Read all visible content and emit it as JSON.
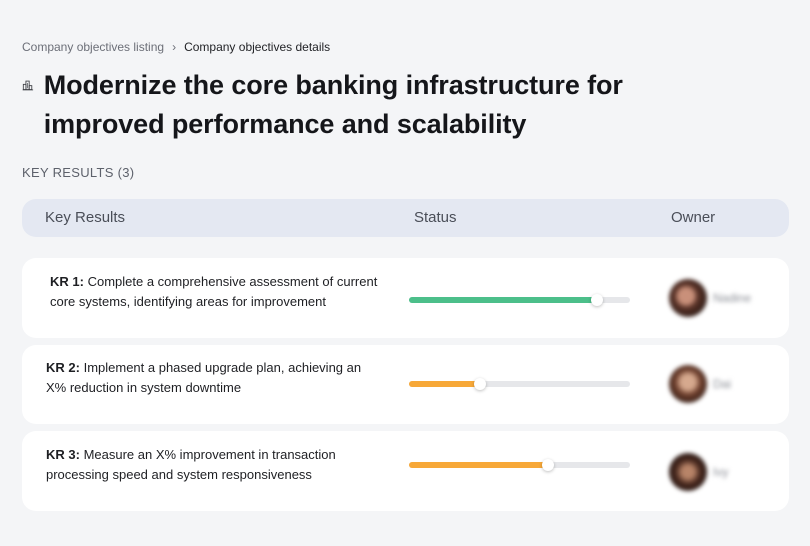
{
  "breadcrumb": {
    "parent": "Company objectives listing",
    "separator": "›",
    "current": "Company objectives details"
  },
  "page": {
    "title": "Modernize the core banking infrastructure for improved performance and scalability",
    "icon": "building-icon"
  },
  "key_results_section": {
    "label": "KEY RESULTS (3)"
  },
  "table": {
    "columns": {
      "key_results": "Key Results",
      "status": "Status",
      "owner": "Owner"
    },
    "rows": [
      {
        "kr_label": "KR 1:",
        "description": "Complete a comprehensive assessment of current core systems, identifying areas for improvement",
        "progress": 0.85,
        "status_color": "#4cbf8a",
        "owner_name": "Nadine"
      },
      {
        "kr_label": "KR 2:",
        "description": "Implement a phased upgrade plan, achieving an X% reduction in system downtime",
        "progress": 0.32,
        "status_color": "#f7a838",
        "owner_name": "Dai"
      },
      {
        "kr_label": "KR 3:",
        "description": "Measure an X% improvement in transaction processing speed and system responsiveness",
        "progress": 0.63,
        "status_color": "#f7a838",
        "owner_name": "Ivy"
      }
    ]
  },
  "colors": {
    "background": "#f4f5f7",
    "header_bg": "#e4e8f2",
    "track": "#e6e7ea",
    "on_track": "#4cbf8a",
    "at_risk": "#f7a838"
  }
}
